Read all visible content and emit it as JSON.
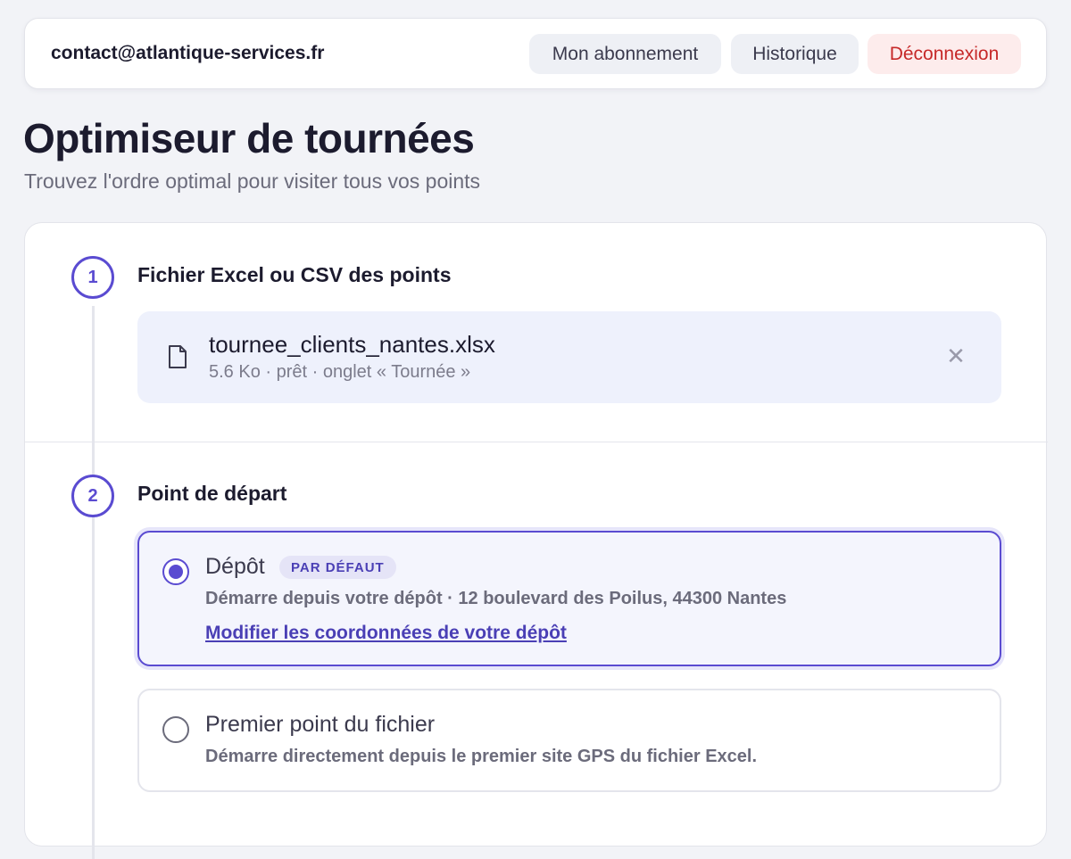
{
  "header": {
    "email": "contact@atlantique-services.fr",
    "subscription_label": "Mon abonnement",
    "history_label": "Historique",
    "logout_label": "Déconnexion"
  },
  "page": {
    "title": "Optimiseur de tournées",
    "subtitle": "Trouvez l'ordre optimal pour visiter tous vos points"
  },
  "steps": [
    {
      "number": "1",
      "title": "Fichier Excel ou CSV des points",
      "file": {
        "name": "tournee_clients_nantes.xlsx",
        "meta": "5.6 Ko · prêt · onglet « Tournée »",
        "remove_symbol": "✕"
      }
    },
    {
      "number": "2",
      "title": "Point de départ",
      "options": [
        {
          "title": "Dépôt",
          "badge": "PAR DÉFAUT",
          "description": "Démarre depuis votre dépôt · 12 boulevard des Poilus, 44300 Nantes",
          "link": "Modifier les coordonnées de votre dépôt",
          "selected": true
        },
        {
          "title": "Premier point du fichier",
          "description": "Démarre directement depuis le premier site GPS du fichier Excel.",
          "selected": false
        }
      ]
    }
  ],
  "colors": {
    "accent": "#5a4bd1",
    "danger": "#c62828",
    "background": "#f2f3f7"
  }
}
